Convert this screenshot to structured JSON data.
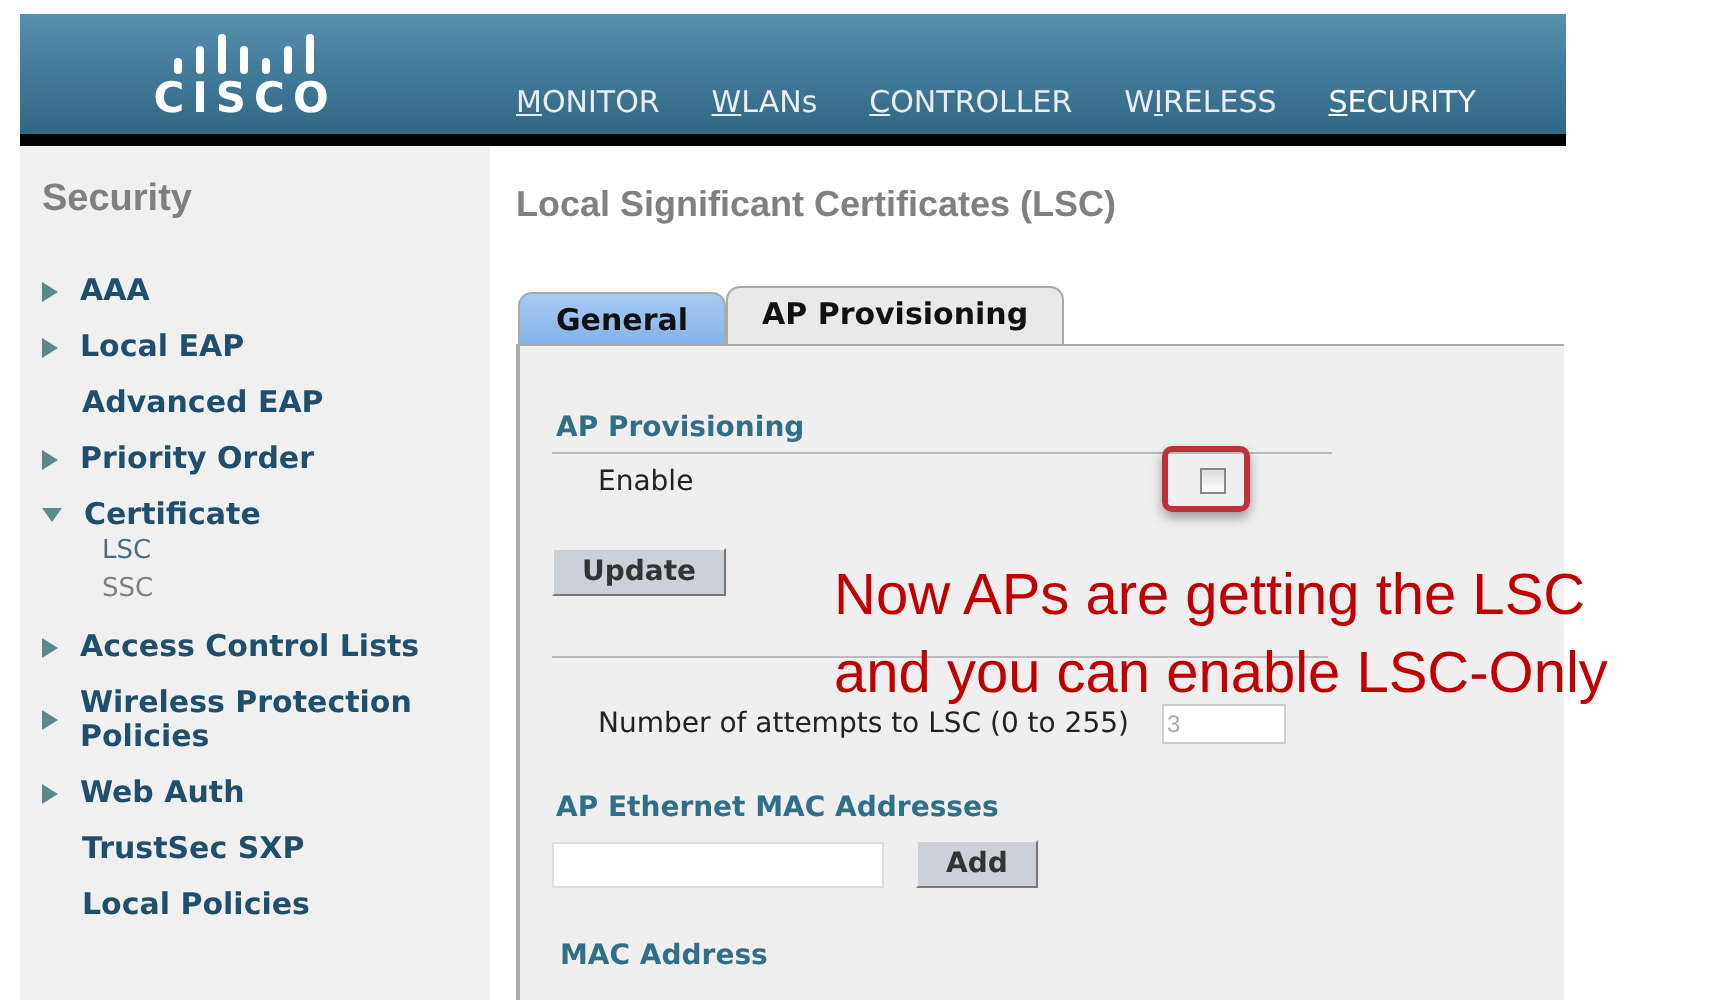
{
  "header": {
    "logo": "CISCO",
    "nav": [
      {
        "key": "M",
        "rest": "ONITOR",
        "selected": false
      },
      {
        "key": "W",
        "rest": "LANs",
        "selected": false
      },
      {
        "key": "C",
        "rest": "ONTROLLER",
        "selected": false
      },
      {
        "key": "I",
        "rest": "RELESS",
        "before": "W",
        "selected": false
      },
      {
        "key": "S",
        "rest": "ECURITY",
        "selected": true
      }
    ]
  },
  "sidebar": {
    "title": "Security",
    "items": [
      {
        "label": "AAA",
        "expanded": false
      },
      {
        "label": "Local EAP",
        "expanded": false
      },
      {
        "label": "Advanced EAP"
      },
      {
        "label": "Priority Order",
        "expanded": false
      },
      {
        "label": "Certificate",
        "expanded": true,
        "children": [
          {
            "label": "LSC",
            "selected": true
          },
          {
            "label": "SSC",
            "selected": false
          }
        ]
      },
      {
        "label": "Access Control Lists",
        "expanded": false
      },
      {
        "label": "Wireless Protection Policies",
        "expanded": false
      },
      {
        "label": "Web Auth",
        "expanded": false
      },
      {
        "label": "TrustSec SXP"
      },
      {
        "label": "Local Policies"
      }
    ]
  },
  "page_title": "Local Significant Certificates (LSC)",
  "tabs": [
    {
      "label": "General",
      "selected": false
    },
    {
      "label": "AP Provisioning",
      "selected": true
    }
  ],
  "provisioning": {
    "heading": "AP Provisioning",
    "enable_label": "Enable",
    "checked": false,
    "update_button": "Update",
    "attempts_label": "Number of attempts to LSC (0 to 255)",
    "attempts_value": "3"
  },
  "mac_section": {
    "heading": "AP Ethernet MAC Addresses",
    "add_button": "Add",
    "list_heading": "MAC Address"
  },
  "annotation": {
    "lines": [
      "Now APs are getting the LSC",
      "and you can enable LSC-Only"
    ]
  }
}
